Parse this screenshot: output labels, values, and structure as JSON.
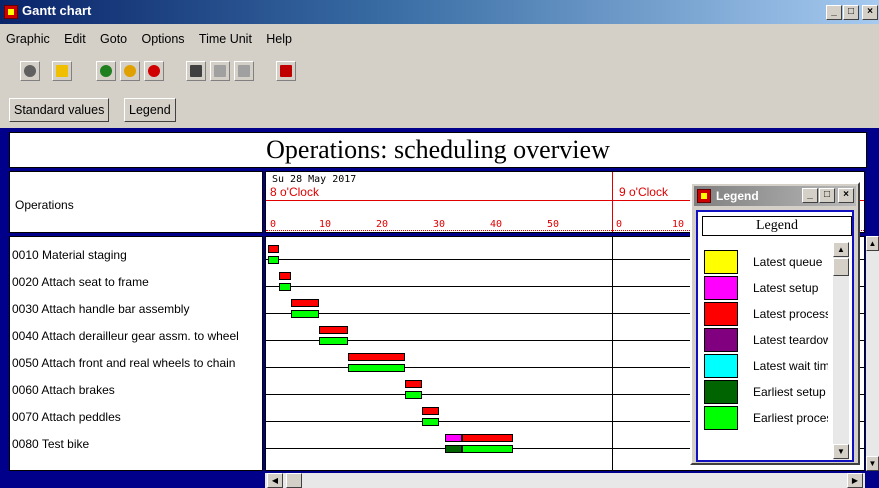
{
  "window": {
    "title": "Gantt chart",
    "min": "_",
    "max": "□",
    "close": "×"
  },
  "menu": [
    "Graphic",
    "Edit",
    "Goto",
    "Options",
    "Time Unit",
    "Help"
  ],
  "buttons": {
    "standard_values": "Standard values",
    "legend": "Legend"
  },
  "header": {
    "title": "Operations: scheduling overview"
  },
  "op_column_label": "Operations",
  "timescale": {
    "date": "Su 28 May 2017",
    "hour1": "8 o'Clock",
    "hour2": "9 o'Clock",
    "ticks1": [
      "0",
      "10",
      "20",
      "30",
      "40",
      "50"
    ],
    "ticks2": [
      "0",
      "10"
    ]
  },
  "operations": [
    "0010 Material staging",
    "0020 Attach seat to frame",
    "0030 Attach handle bar assembly",
    "0040 Attach derailleur gear assm. to wheel",
    "0050 Attach front and real wheels to chain",
    "0060 Attach brakes",
    "0070 Attach peddles",
    "0080 Test bike"
  ],
  "colors": {
    "latest_queue": "#ffff00",
    "latest_setup": "#ff00ff",
    "latest_processing": "#ff0000",
    "latest_teardown": "#800080",
    "latest_wait": "#00ffff",
    "earliest_setup": "#006400",
    "earliest_processing": "#00ff00"
  },
  "legend": {
    "window_title": "Legend",
    "heading": "Legend",
    "items": [
      {
        "label": "Latest queue",
        "color": "#ffff00"
      },
      {
        "label": "Latest setup",
        "color": "#ff00ff"
      },
      {
        "label": "Latest processing",
        "color": "#ff0000"
      },
      {
        "label": "Latest teardown",
        "color": "#800080"
      },
      {
        "label": "Latest wait time",
        "color": "#00ffff"
      },
      {
        "label": "Earliest setup",
        "color": "#006400"
      },
      {
        "label": "Earliest processing",
        "color": "#00ff00"
      }
    ]
  },
  "gantt": [
    {
      "op": "0010",
      "bars": [
        {
          "kind": "latest_processing",
          "start": 0,
          "end": 2
        },
        {
          "kind": "earliest_processing",
          "start": 0,
          "end": 2
        }
      ]
    },
    {
      "op": "0020",
      "bars": [
        {
          "kind": "latest_processing",
          "start": 2,
          "end": 4
        },
        {
          "kind": "earliest_processing",
          "start": 2,
          "end": 4
        }
      ]
    },
    {
      "op": "0030",
      "bars": [
        {
          "kind": "latest_processing",
          "start": 4,
          "end": 9
        },
        {
          "kind": "earliest_processing",
          "start": 4,
          "end": 9
        }
      ]
    },
    {
      "op": "0040",
      "bars": [
        {
          "kind": "latest_processing",
          "start": 9,
          "end": 14
        },
        {
          "kind": "earliest_processing",
          "start": 9,
          "end": 14
        }
      ]
    },
    {
      "op": "0050",
      "bars": [
        {
          "kind": "latest_processing",
          "start": 14,
          "end": 24
        },
        {
          "kind": "earliest_processing",
          "start": 14,
          "end": 24
        }
      ]
    },
    {
      "op": "0060",
      "bars": [
        {
          "kind": "latest_processing",
          "start": 24,
          "end": 27
        },
        {
          "kind": "earliest_processing",
          "start": 24,
          "end": 27
        }
      ]
    },
    {
      "op": "0070",
      "bars": [
        {
          "kind": "latest_processing",
          "start": 27,
          "end": 30
        },
        {
          "kind": "earliest_processing",
          "start": 27,
          "end": 30
        }
      ]
    },
    {
      "op": "0080",
      "bars": [
        {
          "kind": "latest_setup",
          "start": 31,
          "end": 34
        },
        {
          "kind": "latest_processing",
          "start": 34,
          "end": 43
        },
        {
          "kind": "earliest_setup",
          "start": 31,
          "end": 34
        },
        {
          "kind": "earliest_processing",
          "start": 34,
          "end": 43
        }
      ]
    }
  ]
}
